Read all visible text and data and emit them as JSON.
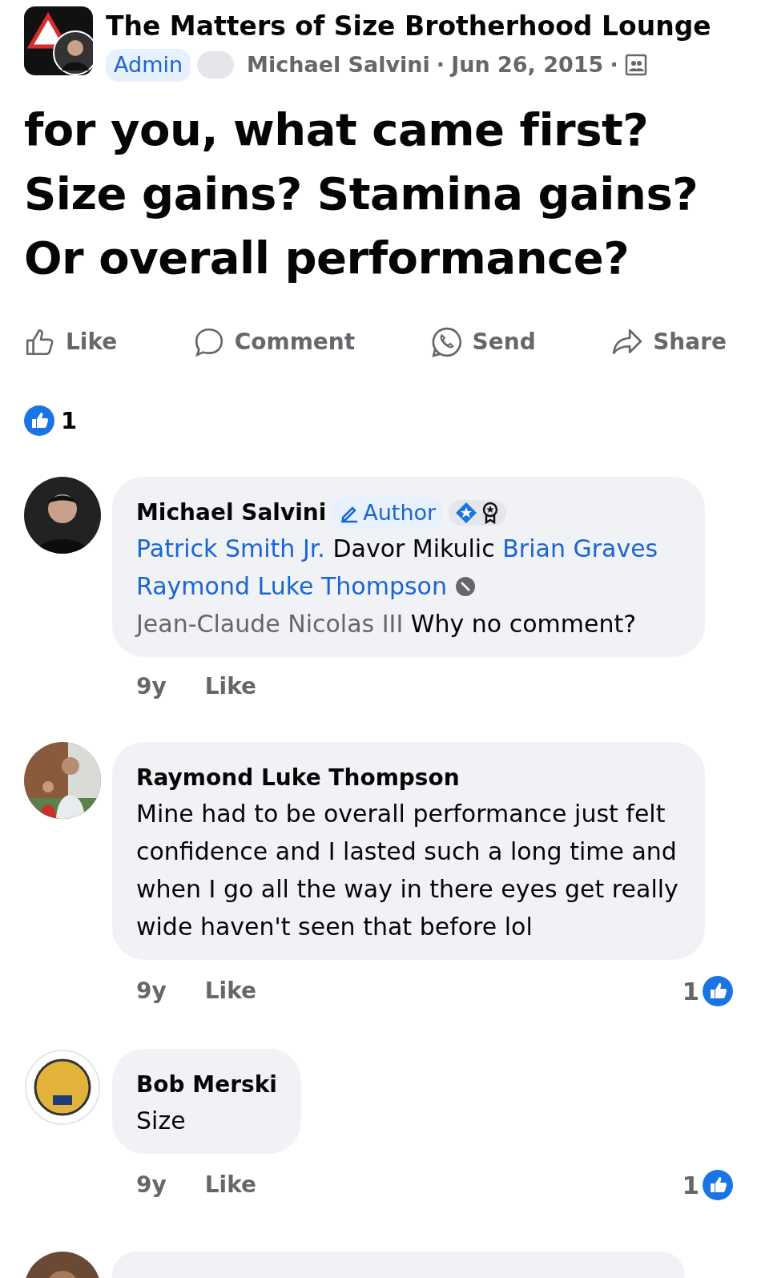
{
  "group": {
    "name": "The Matters of Size Brotherhood Lounge"
  },
  "post_meta": [
    {
      "kind": "badge",
      "text": "Admin"
    },
    {
      "kind": "blank"
    },
    {
      "kind": "author",
      "text": "Michael Salvini"
    },
    {
      "kind": "sep",
      "text": "·"
    },
    {
      "kind": "date",
      "text": "Jun 26, 2015"
    },
    {
      "kind": "sep",
      "text": "·"
    },
    {
      "kind": "audience"
    }
  ],
  "post": {
    "text": "for you, what came first? Size gains? Stamina gains? Or overall performance?"
  },
  "actions": [
    {
      "kind": "like",
      "label": "Like"
    },
    {
      "kind": "comment",
      "label": "Comment"
    },
    {
      "kind": "send",
      "label": "Send"
    },
    {
      "kind": "share",
      "label": "Share"
    }
  ],
  "reactions": {
    "count": "1"
  },
  "comments": [
    {
      "author": "Michael Salvini",
      "badge": "Author",
      "fan_badges": true,
      "segments": [
        {
          "kind": "tag",
          "text": "Patrick Smith Jr."
        },
        {
          "kind": "plain",
          "text": "Davor Mikulic"
        },
        {
          "kind": "tag",
          "text": "Brian Graves"
        },
        {
          "kind": "tag",
          "text": "Raymond Luke Thompson",
          "blocked": true
        },
        {
          "kind": "inactive",
          "text": "Jean-Claude Nicolas III"
        },
        {
          "kind": "plain",
          "text": "Why no comment?"
        }
      ],
      "time": "9y",
      "like_label": "Like"
    },
    {
      "author": "Raymond Luke Thompson",
      "segments": [
        {
          "kind": "plain",
          "text": "Mine had to be overall performance just felt confidence and I lasted such a long time and when I go all the way in there eyes get really wide haven't seen that before lol"
        }
      ],
      "time": "9y",
      "like_label": "Like",
      "reaction_count": "1"
    },
    {
      "author": "Bob Merski",
      "segments": [
        {
          "kind": "plain",
          "text": "Size"
        }
      ],
      "time": "9y",
      "like_label": "Like",
      "reaction_count": "1"
    },
    {
      "kind": "cut_off"
    }
  ]
}
